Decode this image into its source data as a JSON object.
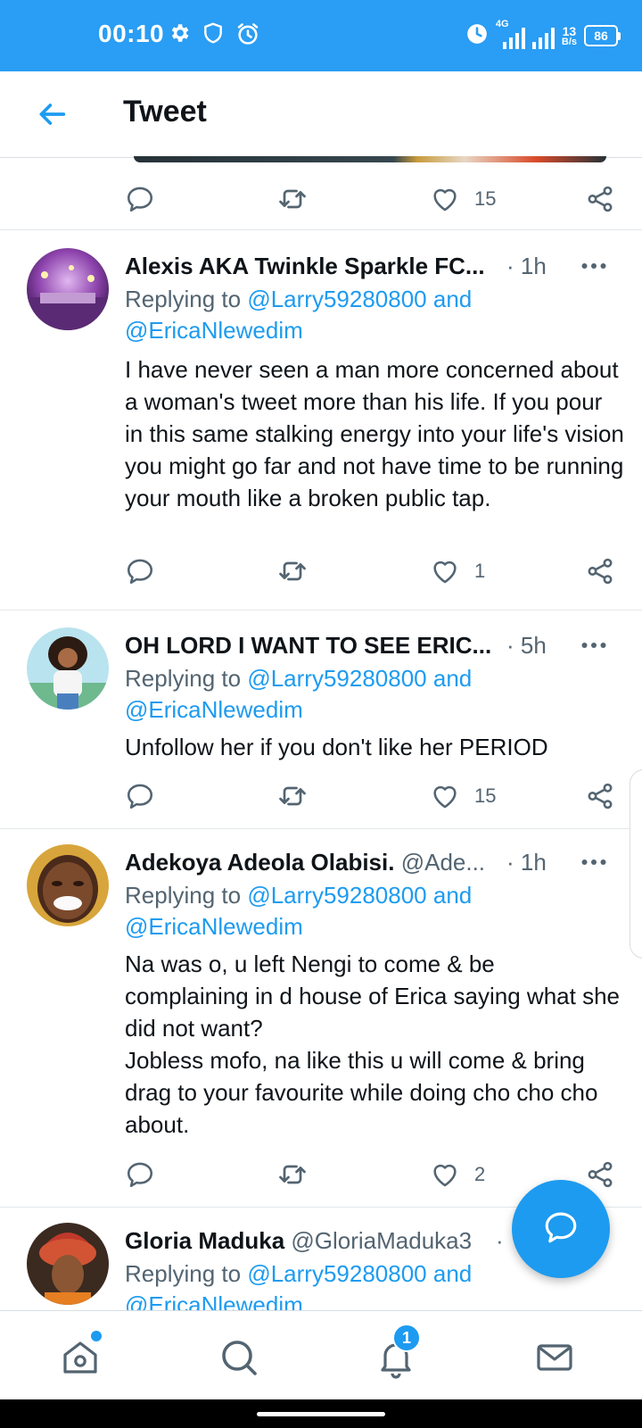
{
  "status_bar": {
    "time": "00:10",
    "network_type": "4G",
    "speed_value": "13",
    "speed_unit": "B/s",
    "battery": "86"
  },
  "header": {
    "title": "Tweet"
  },
  "top_actions": {
    "like_count": "15"
  },
  "tweets": [
    {
      "name": "Alexis AKA Twinkle Sparkle FC...",
      "handle": "",
      "time": "· 1h",
      "replying_prefix": "Replying to",
      "mention_1": "@Larry59280800",
      "mention_and": "and",
      "mention_2": "@EricaNlewedim",
      "text": "I have never seen a man more concerned about a woman's tweet more than his life. If you pour in this same stalking energy into your life's vision you might go far and not have time to be running your mouth like a broken public tap.",
      "like_count": "1"
    },
    {
      "name": "OH LORD I WANT TO SEE ERIC...",
      "handle": "",
      "time": "· 5h",
      "replying_prefix": "Replying to",
      "mention_1": "@Larry59280800",
      "mention_and": "and",
      "mention_2": "@EricaNlewedim",
      "text": "Unfollow her if you don't like her PERIOD",
      "like_count": "15"
    },
    {
      "name": "Adekoya Adeola Olabisi.",
      "handle": "@Ade...",
      "time": "· 1h",
      "replying_prefix": "Replying to",
      "mention_1": "@Larry59280800",
      "mention_and": "and",
      "mention_2": "@EricaNlewedim",
      "text": "Na was o, u left Nengi to come & be complaining in d house of Erica saying what she did not want?\nJobless mofo, na like this u will come & bring drag to your favourite while doing cho cho cho about.",
      "like_count": "2"
    },
    {
      "name": "Gloria Maduka",
      "handle": "@GloriaMaduka3",
      "time": "·",
      "replying_prefix": "Replying to",
      "mention_1": "@Larry59280800",
      "mention_and": "and",
      "mention_2": "@EricaNlewedim",
      "text": "",
      "like_count": ""
    }
  ],
  "bottom_nav": {
    "notifications_badge": "1"
  },
  "colors": {
    "status_bar": "#2a9df4",
    "accent": "#1d9bf0",
    "secondary_text": "#536471",
    "primary_text": "#0f1419"
  },
  "icons": [
    "back-arrow-icon",
    "settings-gear-icon",
    "shield-icon",
    "alarm-icon",
    "reply-icon",
    "retweet-icon",
    "like-heart-icon",
    "share-icon",
    "more-icon",
    "compose-icon",
    "home-icon",
    "search-icon",
    "notifications-bell-icon",
    "messages-mail-icon"
  ]
}
